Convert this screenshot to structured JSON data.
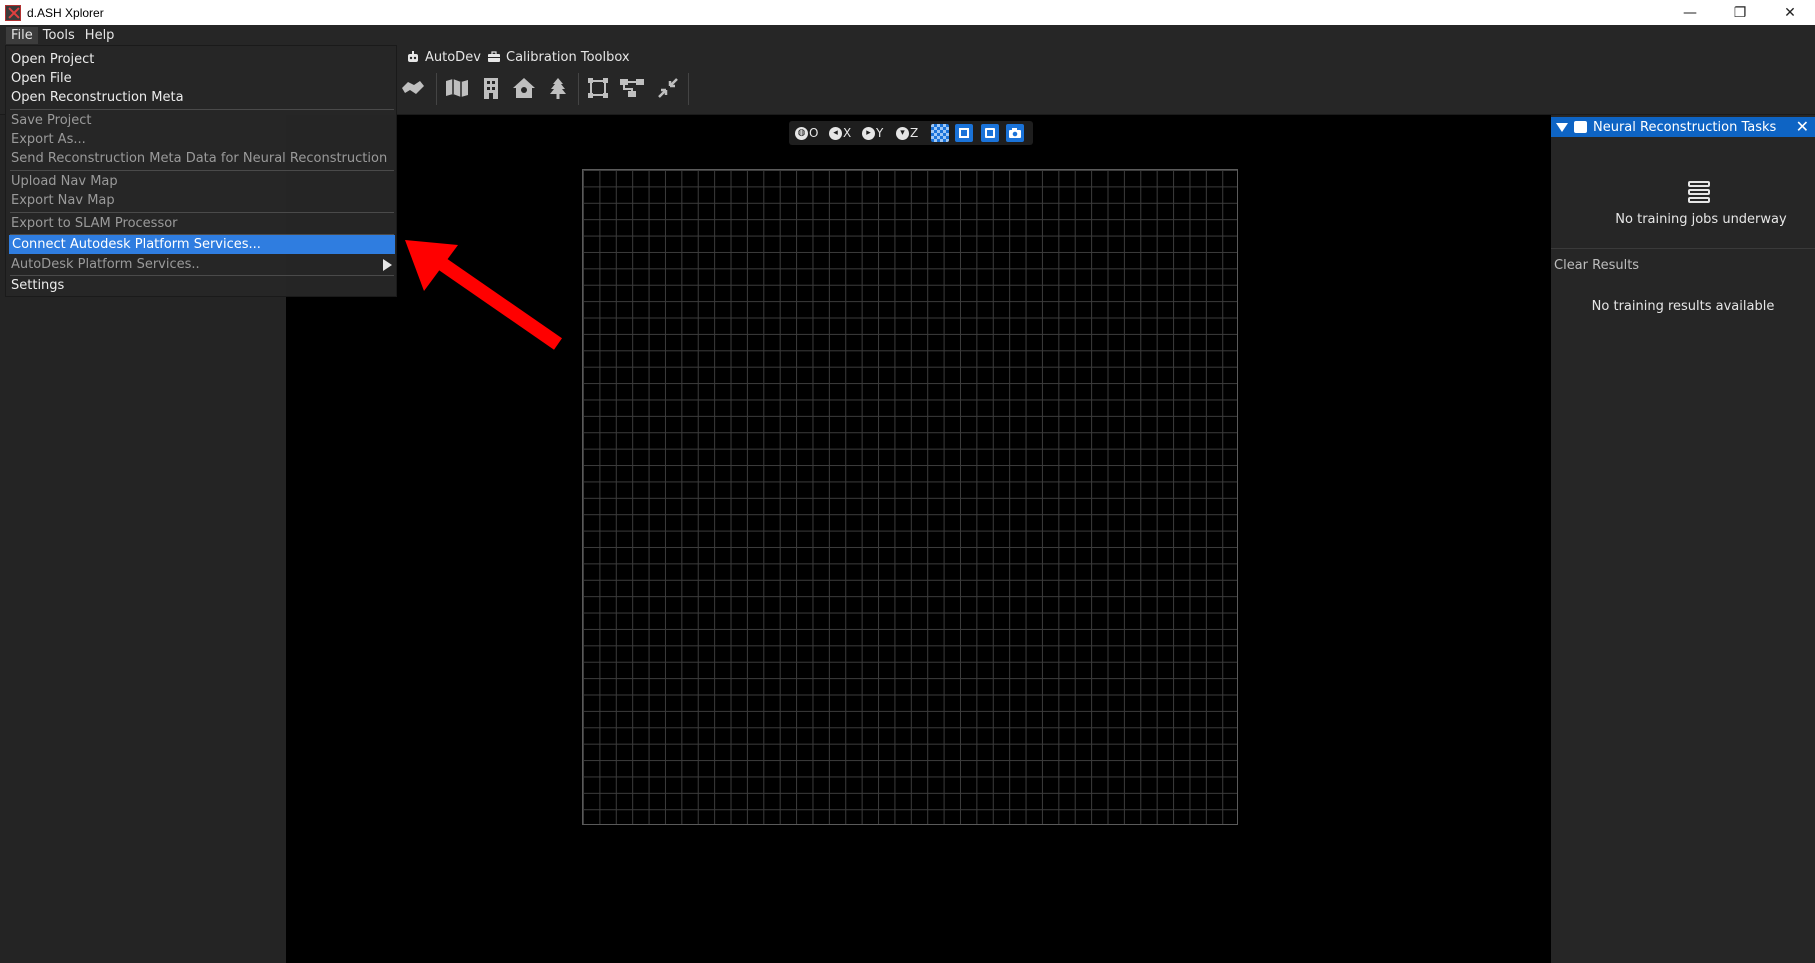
{
  "app": {
    "title": "d.ASH Xplorer"
  },
  "window_controls": {
    "minimize": "—",
    "maximize": "❐",
    "close": "✕"
  },
  "menubar": {
    "items": [
      "File",
      "Tools",
      "Help"
    ]
  },
  "tabs": [
    {
      "label": "AutoDev"
    },
    {
      "label": "Calibration Toolbox"
    }
  ],
  "viewport_toolbar": {
    "origin": "O",
    "x": "X",
    "y": "Y",
    "z": "Z"
  },
  "file_menu": {
    "items": [
      {
        "label": "Open Project",
        "enabled": true
      },
      {
        "label": "Open File",
        "enabled": true
      },
      {
        "label": "Open Reconstruction Meta",
        "enabled": true
      },
      {
        "label": "Save Project",
        "enabled": false
      },
      {
        "label": "Export As...",
        "enabled": false
      },
      {
        "label": "Send Reconstruction Meta Data for Neural Reconstruction",
        "enabled": false
      },
      {
        "label": "Upload Nav Map",
        "enabled": false
      },
      {
        "label": "Export Nav Map",
        "enabled": false
      },
      {
        "label": "Export to SLAM Processor",
        "enabled": false
      },
      {
        "label": "Connect Autodesk Platform Services...",
        "enabled": true,
        "highlighted": true
      },
      {
        "label": "AutoDesk Platform Services..",
        "enabled": false,
        "submenu": true
      },
      {
        "label": "Settings",
        "enabled": true
      }
    ]
  },
  "right_panel": {
    "title": "Neural Reconstruction Tasks",
    "no_jobs": "No training jobs underway",
    "clear_results": "Clear Results",
    "no_results": "No training results available"
  },
  "colors": {
    "accent": "#2f7de0",
    "panel_header": "#0e64c4",
    "annotation_arrow": "#ff0000"
  }
}
